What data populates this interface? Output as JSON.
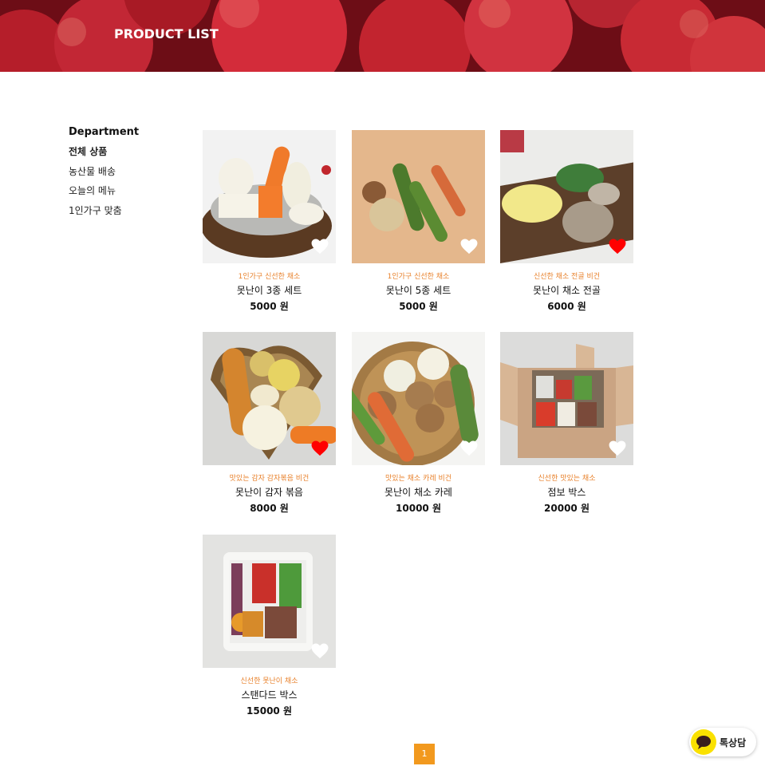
{
  "banner": {
    "title": "PRODUCT LIST"
  },
  "sidebar": {
    "heading": "Department",
    "items": [
      {
        "label": "전체 상품",
        "active": true
      },
      {
        "label": "농산물 배송"
      },
      {
        "label": "오늘의 메뉴"
      },
      {
        "label": "1인가구 맞춤"
      }
    ]
  },
  "products": [
    {
      "tags": "1인가구 신선한 채소",
      "name": "못난이 3종 세트",
      "price": "5000 원",
      "liked": false,
      "icon": "vegetables-photo"
    },
    {
      "tags": "1인가구 신선한 채소",
      "name": "못난이 5종 세트",
      "price": "5000 원",
      "liked": false,
      "icon": "vegetables-photo"
    },
    {
      "tags": "신선한 채소 전골 비건",
      "name": "못난이 채소 전골",
      "price": "6000 원",
      "liked": true,
      "icon": "vegetables-photo"
    },
    {
      "tags": "맛있는 감자 감자볶음 비건",
      "name": "못난이 감자 볶음",
      "price": "8000 원",
      "liked": true,
      "icon": "vegetables-photo"
    },
    {
      "tags": "맛있는 채소 카레 비건",
      "name": "못난이 채소 카레",
      "price": "10000 원",
      "liked": false,
      "icon": "vegetables-photo"
    },
    {
      "tags": "신선한 맛있는 채소",
      "name": "점보 박스",
      "price": "20000 원",
      "liked": false,
      "icon": "box-photo"
    },
    {
      "tags": "신선한 못난이 채소",
      "name": "스탠다드 박스",
      "price": "15000 원",
      "liked": false,
      "icon": "box-photo"
    }
  ],
  "pagination": {
    "current": "1"
  },
  "chat": {
    "label": "톡상담"
  },
  "colors": {
    "accent": "#f2991e",
    "tag": "#e8812b",
    "liked": "#ff0000",
    "unliked": "#ffffff",
    "chat": "#fae100"
  }
}
